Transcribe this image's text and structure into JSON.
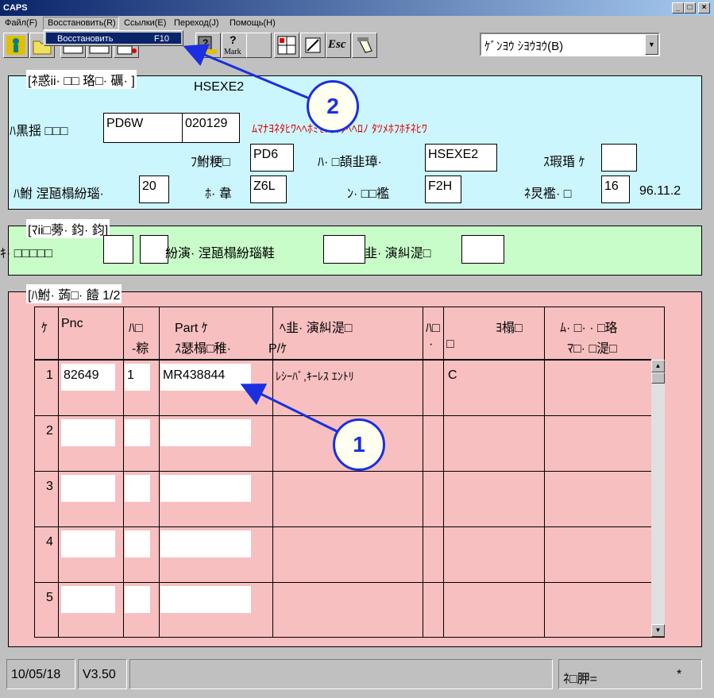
{
  "window": {
    "title": "CAPS",
    "min": "_",
    "max": "□",
    "close": "×"
  },
  "menu": [
    "Файл(F)",
    "Восстановить(R)",
    "Ссылки(E)",
    "Переход(J)",
    "Помощь(H)"
  ],
  "dropdown": {
    "item": "Восстановить",
    "shortcut": "F10"
  },
  "toolbar": {
    "mark_label": "Mark",
    "esc_label": "Esc",
    "combo_value": "ｹﾞﾝﾖｳ ｼﾖｳﾖｳ(B)"
  },
  "section1": {
    "legend": "[ﾈ惑ii· □□ 珞□· 礪· ]",
    "code": "HSEXE2",
    "row1_label": "ﾊ黒揺 □□□",
    "model": "PD6W",
    "date": "020129",
    "red_text": "ﾑﾏﾅﾖﾈﾀﾋﾜﾍﾍﾎﾐﾓﾄﾎｻﾀﾍﾍﾛﾉ ﾀﾂﾒﾎﾌﾎﾁﾈﾋﾜ",
    "f1_label": "ﾌ鮒粳□",
    "f1_value": "PD6",
    "f2_label": "ﾊ· □頡韭璋·",
    "f2_value": "HSEXE2",
    "f3_label": "ｽ瑕琘 ｹ",
    "f3_value": "",
    "f4_label": "ﾊ鮒 涅瓸榻紛瑙·",
    "f4_value": "20",
    "f5_label": "ﾎ· 韋",
    "f5_value": "Z6L",
    "f6_label": "ﾝ· □□襤",
    "f6_value": "F2H",
    "f7_label": "ﾈ炅襤· □",
    "f7_value": "16",
    "version_date": "96.11.2"
  },
  "section2": {
    "legend": "[ﾏii□蒡· 鈞· 鈞]",
    "left_label": "ｷ· □□□□□",
    "mid_label": "紛演· 涅瓸榻紛瑙鞋",
    "right_label": "韭· 演糾湜□"
  },
  "section3": {
    "legend": "[ﾊ鮒· 蒟□· 饐 1/2",
    "headers": [
      "ｹ",
      "Pnc",
      "ﾊ□",
      "-粽",
      "Part ｹ",
      "ｽ瑟榻□稚·",
      "ﾍ韭· 演糾湜□",
      "P/ｹ",
      "ﾊ□",
      "·",
      "□",
      "ﾖ榻□",
      "ﾑ· □· · □珞",
      "ﾏ□· □湜□"
    ],
    "rows": [
      {
        "num": "1",
        "pnc": "82649",
        "qty": "1",
        "part": "MR438844",
        "name": "ﾚｼｰﾊﾞ,ｷｰﾚｽ ｴﾝﾄﾘ",
        "col": "C"
      },
      {
        "num": "2",
        "pnc": "",
        "qty": "",
        "part": "",
        "name": "",
        "col": ""
      },
      {
        "num": "3",
        "pnc": "",
        "qty": "",
        "part": "",
        "name": "",
        "col": ""
      },
      {
        "num": "4",
        "pnc": "",
        "qty": "",
        "part": "",
        "name": "",
        "col": ""
      },
      {
        "num": "5",
        "pnc": "",
        "qty": "",
        "part": "",
        "name": "",
        "col": ""
      }
    ]
  },
  "status": {
    "date": "10/05/18",
    "version": "V3.50",
    "middle": "",
    "right_label": "ﾈ□胛=",
    "right_value": "*"
  },
  "callouts": [
    "2",
    "1"
  ],
  "colors": {
    "section1_bg": "#ccf6fe",
    "section2_bg": "#c8fcc8",
    "section3_bg": "#f7bfc0",
    "callout": "#1a2fe0",
    "red_text": "#e00000"
  }
}
